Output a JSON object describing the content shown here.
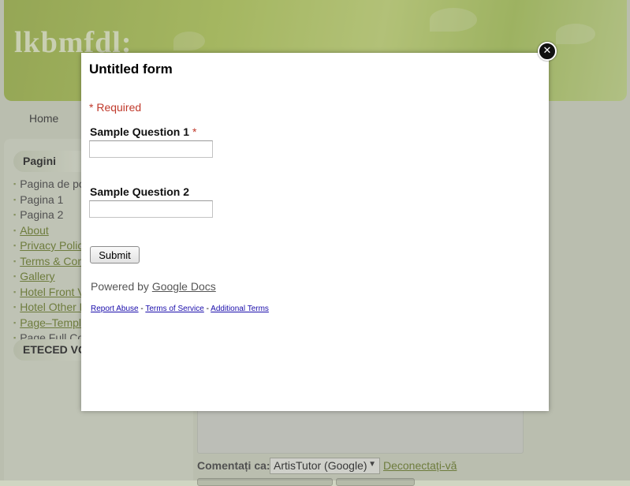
{
  "site": {
    "title": "lkbmfdl:",
    "nav": [
      "Home"
    ]
  },
  "sidebar": {
    "pages_title": "Pagini",
    "pages": [
      {
        "label": "Pagina de po",
        "link": false
      },
      {
        "label": "Pagina 1",
        "link": false
      },
      {
        "label": "Pagina 2",
        "link": false
      },
      {
        "label": "About",
        "link": true
      },
      {
        "label": "Privacy Polic",
        "link": true
      },
      {
        "label": "Terms & Con",
        "link": true
      },
      {
        "label": "Gallery",
        "link": true
      },
      {
        "label": "Hotel Front V",
        "link": true
      },
      {
        "label": "Hotel Other F",
        "link": true
      },
      {
        "label": "Page–Templ",
        "link": true
      },
      {
        "label": "Page Full Co",
        "link": false
      }
    ],
    "widget2_title": "ETECED VG"
  },
  "comments": {
    "comment_as_label": "Comentați ca:",
    "account_selected": "ArtisTutor (Google)",
    "signout_link": "Deconectați-vă"
  },
  "modal": {
    "close_symbol": "✕",
    "form_title": "Untitled form",
    "required_note": "* Required",
    "questions": [
      {
        "label": "Sample Question 1",
        "required_marker": "*",
        "value": ""
      },
      {
        "label": "Sample Question 2",
        "required_marker": "",
        "value": ""
      }
    ],
    "submit_label": "Submit",
    "powered_prefix": "Powered by",
    "powered_link": "Google Docs",
    "footer": {
      "report_abuse": "Report Abuse",
      "sep": "-",
      "terms": "Terms of Service",
      "additional": "Additional Terms"
    }
  },
  "colors": {
    "header_green": "#b4cc5a",
    "page_bg": "#d0d6c2",
    "required_red": "#c0392b",
    "link_green": "#6b7e2a"
  }
}
